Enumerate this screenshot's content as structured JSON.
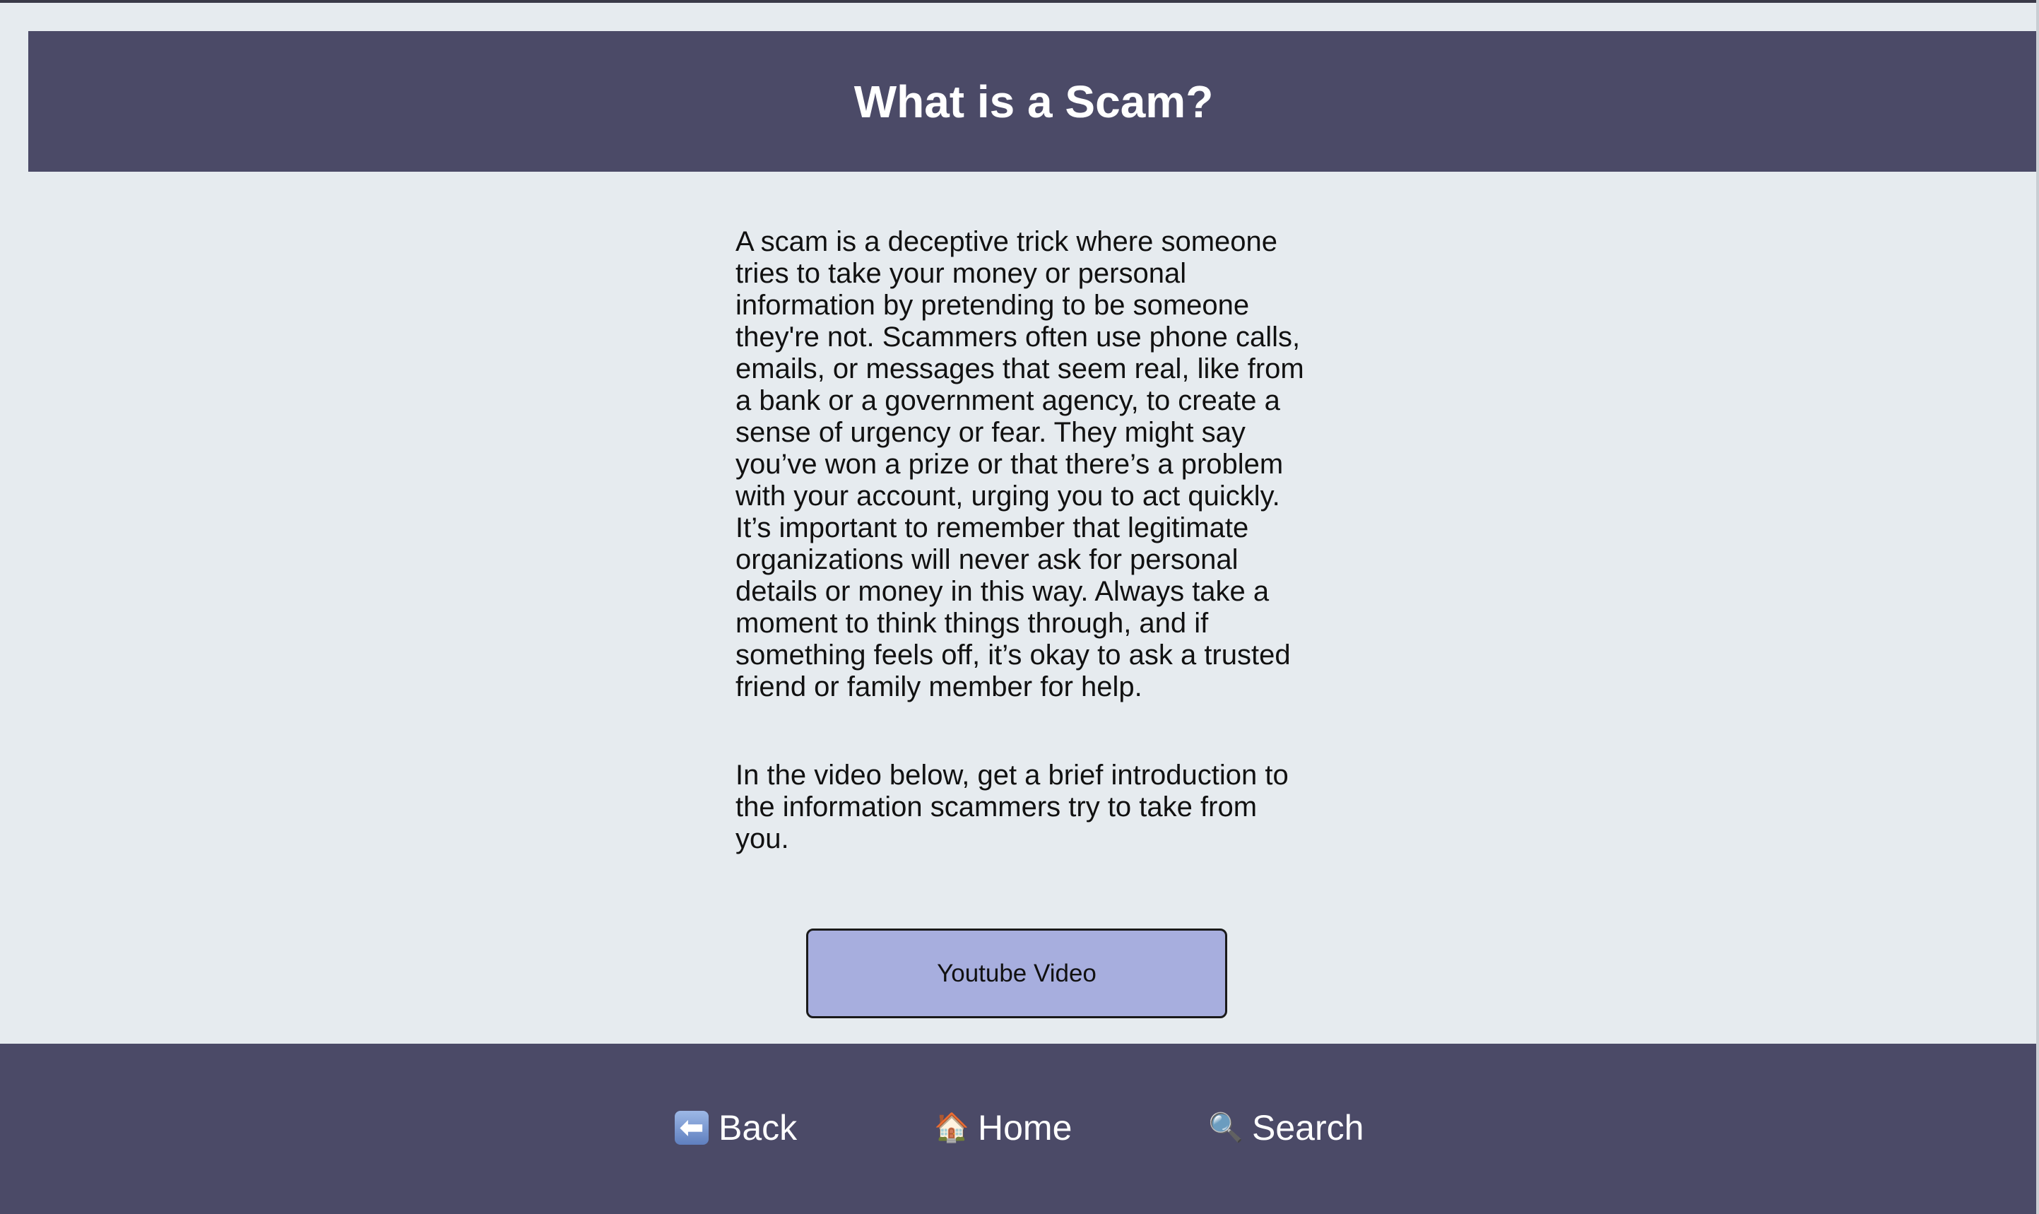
{
  "header": {
    "title": "What is a Scam?"
  },
  "content": {
    "paragraph_1": "A scam is a deceptive trick where someone tries to take your money or personal information by pretending to be someone they're not. Scammers often use phone calls, emails, or messages that seem real, like from a bank or a government agency, to create a sense of urgency or fear. They might say you’ve won a prize or that there’s a problem with your account, urging you to act quickly. It’s important to remember that legitimate organizations will never ask for personal details or money in this way. Always take a moment to think things through, and if something feels off, it’s okay to ask a trusted friend or family member for help.",
    "paragraph_2": "In the video below, get a brief introduction to the information scammers try to take from you.",
    "video_button_label": "Youtube Video"
  },
  "footer": {
    "nav": [
      {
        "label": "Back",
        "icon": "back-arrow-icon",
        "glyph": "⬅"
      },
      {
        "label": "Home",
        "icon": "house-icon",
        "glyph": "🏠"
      },
      {
        "label": "Search",
        "icon": "magnifier-icon",
        "glyph": "🔍"
      }
    ]
  },
  "colors": {
    "header_bg": "#4b4a67",
    "page_bg": "#e6ebef",
    "button_bg": "#a7aede",
    "footer_bg": "#4b4a67"
  }
}
